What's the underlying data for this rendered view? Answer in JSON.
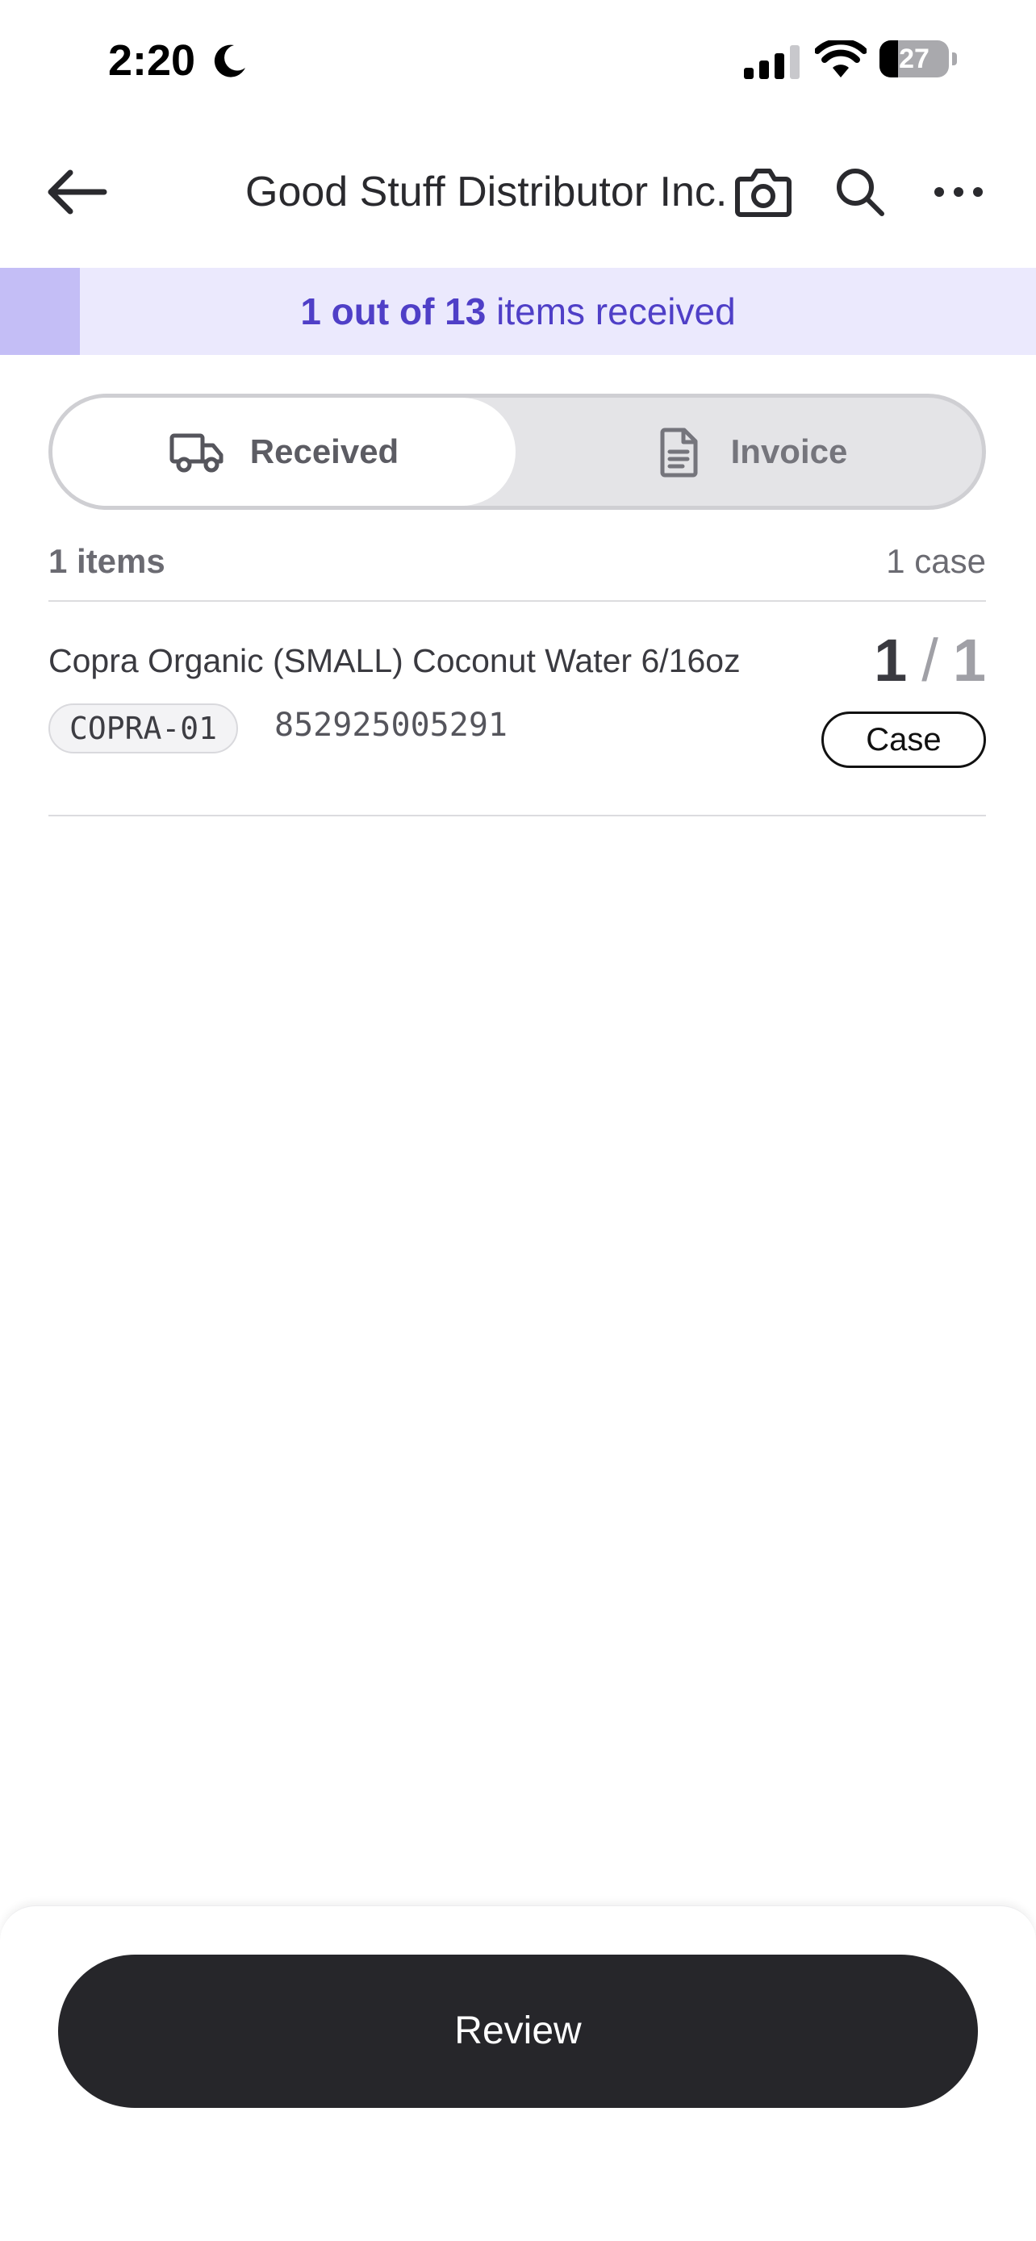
{
  "status_bar": {
    "time": "2:20",
    "battery_level": "27",
    "battery_fraction": 0.27,
    "icons": [
      "moon-icon",
      "cellular-signal-icon",
      "wifi-icon",
      "battery-icon"
    ]
  },
  "nav": {
    "title": "Good Stuff Distributor Inc.",
    "icons": [
      "back-arrow-icon",
      "camera-icon",
      "search-icon",
      "more-horizontal-icon"
    ]
  },
  "progress": {
    "count_text": "1 out of 13",
    "suffix_text": " items received",
    "received": 1,
    "total": 13,
    "fraction": 0.077,
    "accent_color": "#4f3fc7"
  },
  "tabs": [
    {
      "label": "Received",
      "icon": "truck-icon",
      "selected": true
    },
    {
      "label": "Invoice",
      "icon": "document-icon",
      "selected": false
    }
  ],
  "list": {
    "items_count_label": "1 items",
    "cases_count_label": "1 case",
    "items": [
      {
        "name": "Copra Organic (SMALL) Coconut Water 6/16oz",
        "sku": "COPRA-01",
        "barcode": "852925005291",
        "qty_received": "1",
        "qty_separator": "/",
        "qty_total": "1",
        "unit": "Case"
      }
    ]
  },
  "footer": {
    "review_label": "Review",
    "button_color": "#26262a"
  }
}
